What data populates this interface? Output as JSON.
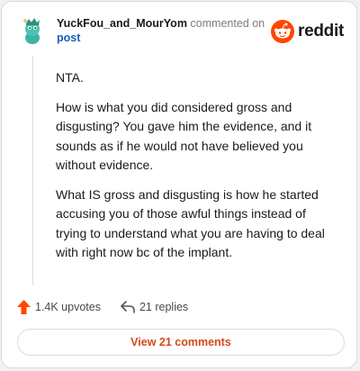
{
  "comment": {
    "username": "YuckFou_and_MourYom",
    "commented_on_text": "commented on",
    "post_link_text": "post",
    "paragraphs": [
      "NTA.",
      "How is what you did considered gross and disgusting? You gave him the evidence, and it sounds as if he would not have believed you without evidence.",
      "What IS gross and disgusting is how he started accusing you of those awful things instead of trying to understand what you are having to deal with right now bc of the implant."
    ]
  },
  "brand": {
    "name": "reddit",
    "accent_color": "#ff4500"
  },
  "actions": {
    "upvotes_label": "1.4K upvotes",
    "replies_label": "21 replies",
    "upvote_icon": "arrow-up-icon",
    "reply_icon": "reply-arrow-icon"
  },
  "footer": {
    "view_comments_label": "View 21 comments"
  }
}
